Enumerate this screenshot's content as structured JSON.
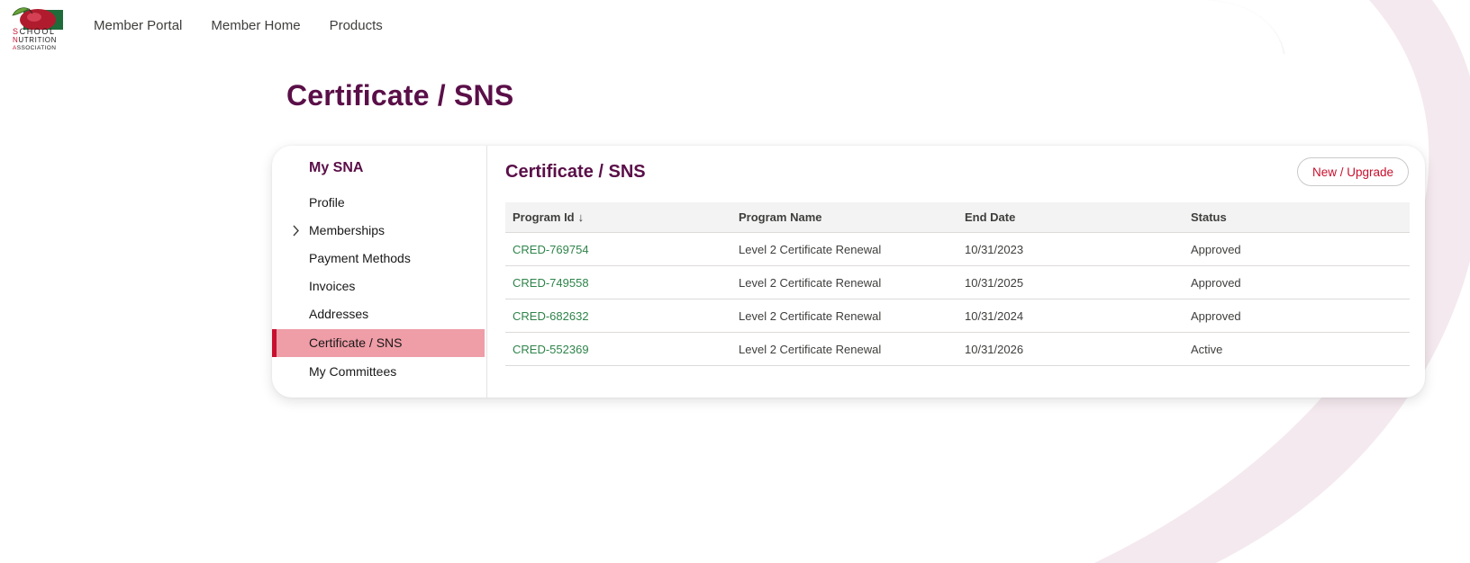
{
  "logo": {
    "line1_first": "S",
    "line1_rest": "CHOOL",
    "line2_first": "N",
    "line2_rest": "UTRITION",
    "line3_first": "A",
    "line3_rest": "SSOCIATION"
  },
  "nav": {
    "items": [
      {
        "label": "Member Portal"
      },
      {
        "label": "Member Home"
      },
      {
        "label": "Products"
      }
    ]
  },
  "page": {
    "title": "Certificate / SNS"
  },
  "sidebar": {
    "heading": "My SNA",
    "items": [
      {
        "label": "Profile"
      },
      {
        "label": "Memberships"
      },
      {
        "label": "Payment Methods"
      },
      {
        "label": "Invoices"
      },
      {
        "label": "Addresses"
      },
      {
        "label": "Certificate / SNS"
      },
      {
        "label": "My Committees"
      }
    ]
  },
  "main": {
    "title": "Certificate / SNS",
    "new_button_label": "New / Upgrade",
    "table": {
      "columns": [
        "Program Id",
        "Program Name",
        "End Date",
        "Status"
      ],
      "sort_icon": "↓",
      "rows": [
        [
          "CRED-769754",
          "Level 2 Certificate Renewal",
          "10/31/2023",
          "Approved"
        ],
        [
          "CRED-749558",
          "Level 2 Certificate Renewal",
          "10/31/2025",
          "Approved"
        ],
        [
          "CRED-682632",
          "Level 2 Certificate Renewal",
          "10/31/2024",
          "Approved"
        ],
        [
          "CRED-552369",
          "Level 2 Certificate Renewal",
          "10/31/2026",
          "Active"
        ]
      ]
    }
  },
  "colors": {
    "brand_purple": "#5a0f48",
    "accent_red": "#c8102e",
    "active_pink": "#ef9da7",
    "link_green": "#2e844a"
  }
}
